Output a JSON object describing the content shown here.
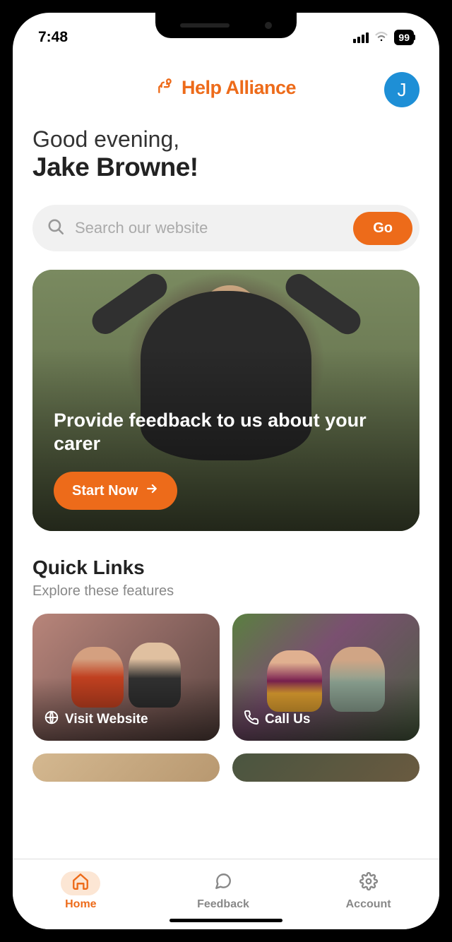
{
  "status": {
    "time": "7:48",
    "battery": "99"
  },
  "header": {
    "app_name": "Help Alliance",
    "avatar_initial": "J"
  },
  "greeting": {
    "line1": "Good evening,",
    "line2": "Jake Browne!"
  },
  "search": {
    "placeholder": "Search our website",
    "go_label": "Go"
  },
  "hero": {
    "text": "Provide feedback to us about your carer",
    "cta": "Start Now"
  },
  "quick_links": {
    "title": "Quick Links",
    "subtitle": "Explore these features",
    "cards": [
      {
        "label": "Visit Website",
        "icon": "globe"
      },
      {
        "label": "Call Us",
        "icon": "phone"
      }
    ]
  },
  "nav": {
    "items": [
      {
        "label": "Home",
        "active": true
      },
      {
        "label": "Feedback",
        "active": false
      },
      {
        "label": "Account",
        "active": false
      }
    ]
  },
  "colors": {
    "accent": "#ed6b1a",
    "avatar": "#1e8fd6"
  }
}
